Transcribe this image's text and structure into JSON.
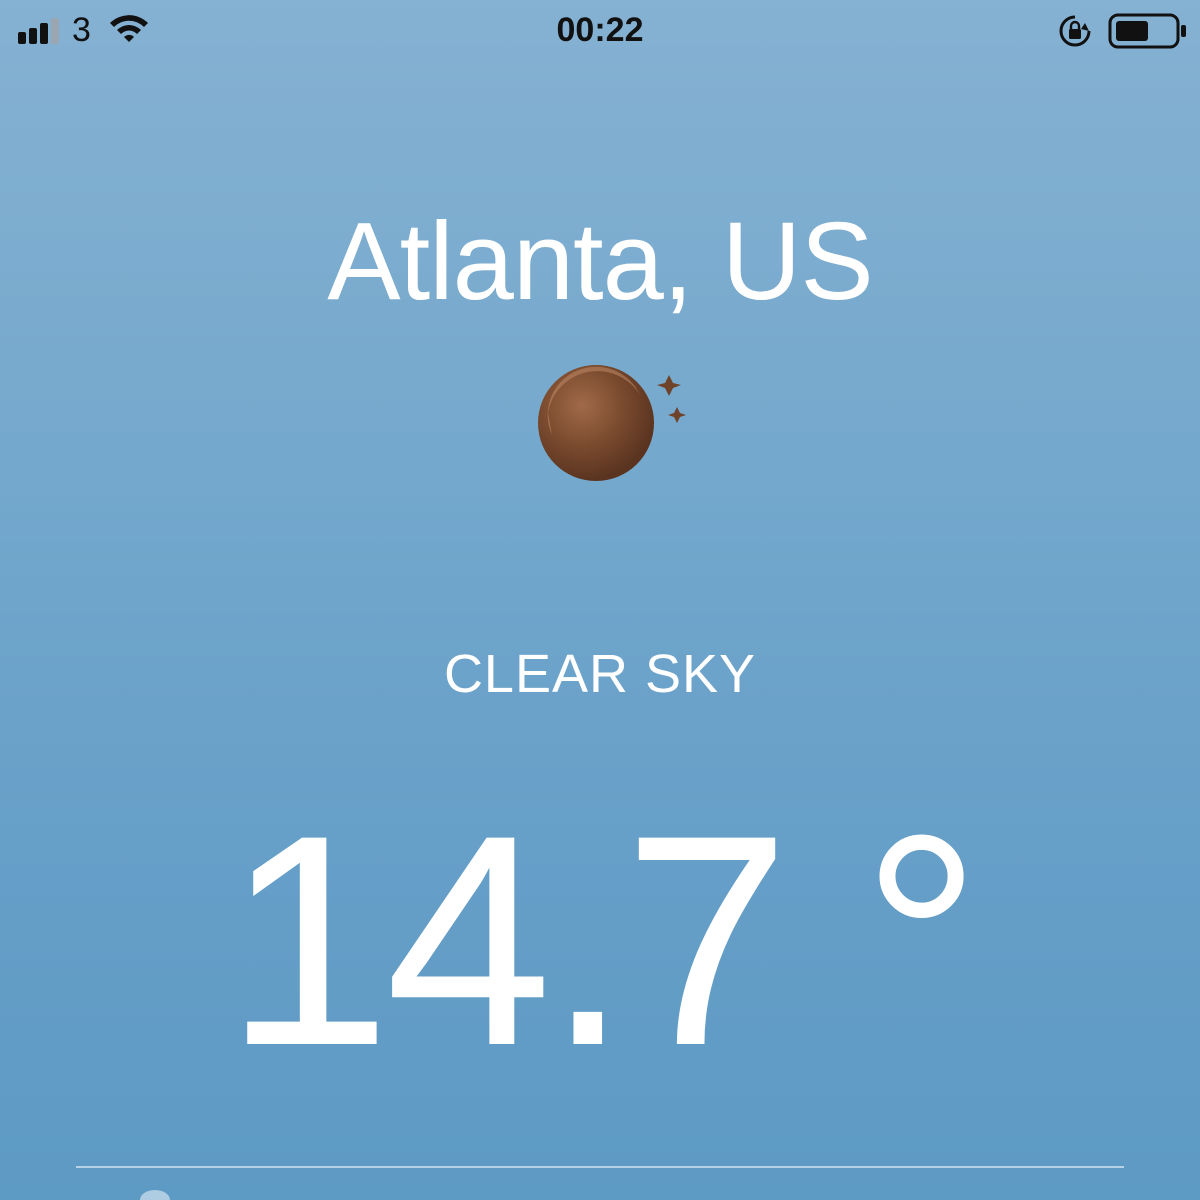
{
  "status_bar": {
    "carrier": "3",
    "time": "00:22",
    "icons": [
      "cellular-signal-icon",
      "wifi-icon",
      "rotation-lock-icon",
      "battery-icon"
    ],
    "text_color": "#111111"
  },
  "weather": {
    "city": "Atlanta, US",
    "condition": "CLEAR SKY",
    "temperature": "14.7 °",
    "icon": "moon-icon",
    "icon_color": "#7a4a2e"
  },
  "colors": {
    "background_top": "#85b1d2",
    "background_bottom": "#5d9ac4",
    "text": "#ffffff"
  }
}
